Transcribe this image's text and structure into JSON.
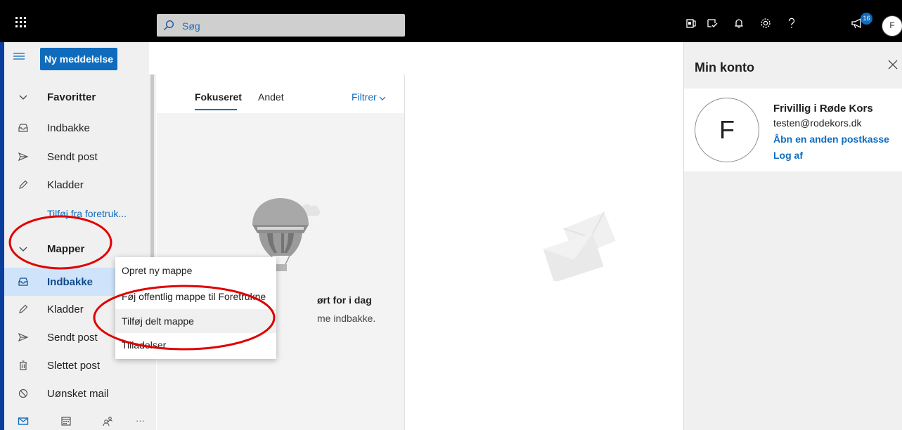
{
  "colors": {
    "accent": "#0f6cbd",
    "selected_bg": "#cfe4fa",
    "annotation": "#e00000"
  },
  "topbar": {
    "search_placeholder": "Søg",
    "notification_count": "16",
    "avatar_initial": "F",
    "icons": [
      "app-launcher-icon",
      "search-icon",
      "office-icon",
      "todo-icon",
      "bell-icon",
      "gear-icon",
      "help-icon",
      "feedback-megaphone-icon"
    ]
  },
  "nav": {
    "new_message": "Ny meddelelse",
    "favorites_header": "Favoritter",
    "favorites": [
      {
        "label": "Indbakke",
        "icon": "inbox-icon"
      },
      {
        "label": "Sendt post",
        "icon": "send-icon"
      },
      {
        "label": "Kladder",
        "icon": "pencil-icon"
      }
    ],
    "add_favorite": "Tilføj fra foretruk...",
    "folders_header": "Mapper",
    "folders": [
      {
        "label": "Indbakke",
        "icon": "inbox-icon",
        "selected": true
      },
      {
        "label": "Kladder",
        "icon": "pencil-icon"
      },
      {
        "label": "Sendt post",
        "icon": "send-icon"
      },
      {
        "label": "Slettet post",
        "icon": "trash-icon"
      },
      {
        "label": "Uønsket mail",
        "icon": "blocked-icon"
      }
    ],
    "bottom_icons": [
      "mail-icon",
      "calendar-icon",
      "people-icon",
      "more-icon"
    ],
    "more_label": "···"
  },
  "message_list": {
    "tab_focused": "Fokuseret",
    "tab_other": "Andet",
    "filter": "Filtrer",
    "empty_title": "ørt for i dag",
    "empty_subtitle": "me indbakke."
  },
  "context_menu": {
    "items": [
      "Opret ny mappe",
      "Føj offentlig mappe til Foretrukne",
      "Tilføj delt mappe",
      "Tilladelser"
    ],
    "highlighted_index": 2
  },
  "account": {
    "title": "Min konto",
    "avatar_initial": "F",
    "name": "Frivillig i Røde Kors",
    "email": "testen@rodekors.dk",
    "open_other": "Åbn en anden postkasse",
    "sign_out": "Log af"
  }
}
